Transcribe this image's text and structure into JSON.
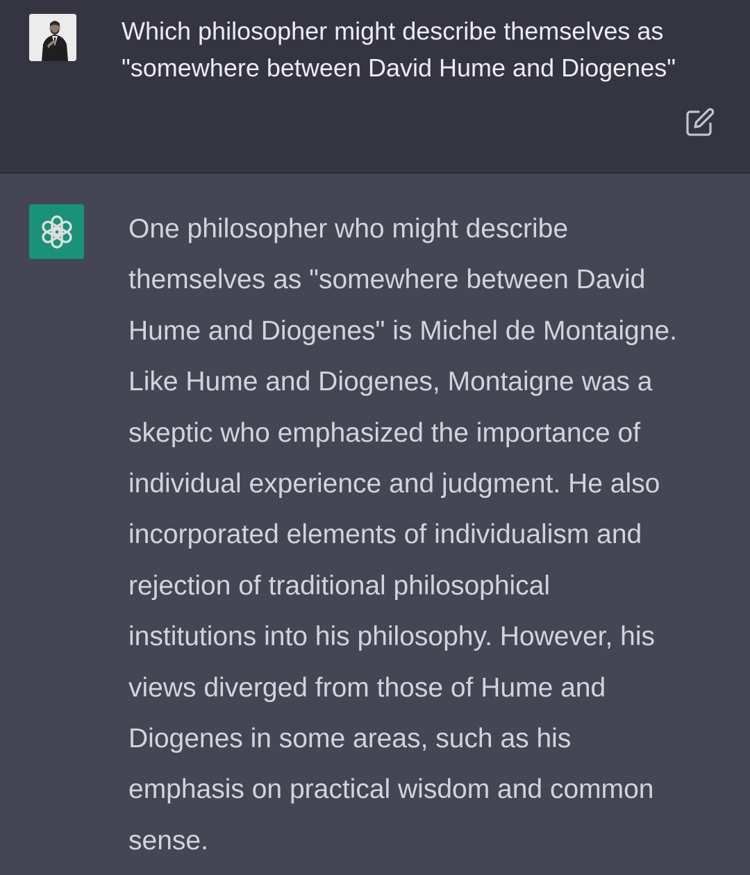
{
  "conversation": {
    "user_message": {
      "avatar_icon": "user-avatar-photo",
      "text": "Which philosopher might describe themselves as\n\"somewhere between David Hume and Diogenes\"",
      "edit_icon": "edit-icon"
    },
    "assistant_message": {
      "avatar_icon": "openai-logo-icon",
      "text": "One philosopher who might describe\nthemselves as \"somewhere between David\nHume and Diogenes\" is Michel de Montaigne.\nLike Hume and Diogenes, Montaigne was a\nskeptic who emphasized the importance of\nindividual experience and judgment. He also\nincorporated elements of individualism and\nrejection of traditional philosophical\ninstitutions into his philosophy. However, his\nviews diverged from those of Hume and\nDiogenes in some areas, such as his\nemphasis on practical wisdom and common\nsense."
    }
  },
  "colors": {
    "user_row_bg": "#343541",
    "assistant_row_bg": "#444654",
    "user_text": "#ececf1",
    "assistant_text": "#d1d5db",
    "assistant_avatar_bg": "#10a37f"
  }
}
